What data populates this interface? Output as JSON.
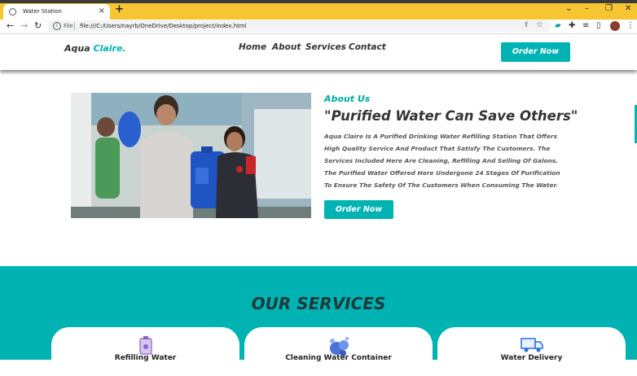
{
  "browser": {
    "tab_title": "Water Station",
    "tab_close": "×",
    "new_tab": "+",
    "proto_label": "File",
    "url": "file:///C:/Users/nayrb/OneDrive/Desktop/project/index.html",
    "accent": "#f7c531"
  },
  "site": {
    "logo_main": "Aqua",
    "logo_accent": "Claire.",
    "nav": [
      "Home",
      "About",
      "Services",
      "Contact"
    ],
    "header_button": "Order Now",
    "accent_color": "#00b3b3"
  },
  "about": {
    "label": "About Us",
    "heading": "\"Purified Water Can Save Others\"",
    "text": "Aqua Claire Is A Purified Drinking Water Refilling Station That Offers High Quality Service And Product That Satisfy The Customers. The Services Included Here Are Cleaning, Refilling And Selling Of Galons. The Purified Water Offered Here Undergone 24 Stages Of Purification To Ensure The Safety Of The Customers When Consuming The Water.",
    "button": "Order Now"
  },
  "services": {
    "title": "OUR SERVICES",
    "cards": [
      {
        "title": "Refilling Water",
        "icon": "water-jug-icon"
      },
      {
        "title": "Cleaning Water Container",
        "icon": "bubbles-icon"
      },
      {
        "title": "Water Delivery",
        "icon": "truck-icon"
      }
    ]
  }
}
